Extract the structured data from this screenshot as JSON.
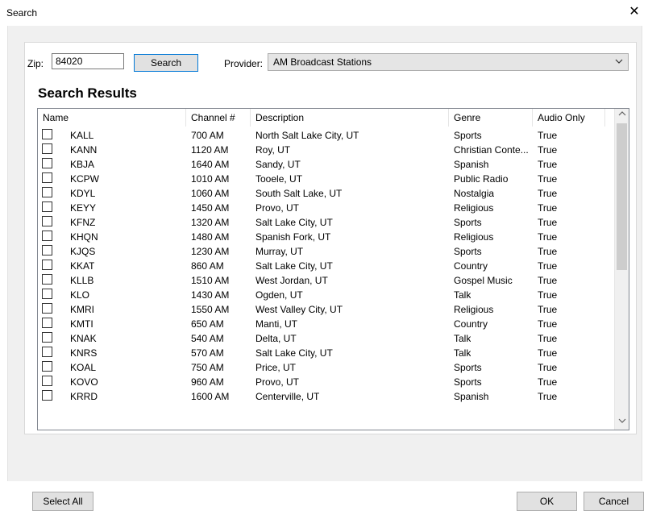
{
  "window": {
    "title": "Search",
    "close_glyph": "✕"
  },
  "search": {
    "zip_label": "Zip:",
    "zip_value": "84020",
    "search_button": "Search",
    "provider_label": "Provider:",
    "provider_value": "AM Broadcast Stations"
  },
  "results": {
    "heading": "Search Results",
    "columns": [
      "Name",
      "Channel #",
      "Description",
      "Genre",
      "Audio Only"
    ],
    "rows": [
      {
        "name": "KALL",
        "channel": "700 AM",
        "description": "North Salt Lake City, UT",
        "genre": "Sports",
        "audio_only": "True"
      },
      {
        "name": "KANN",
        "channel": "1120 AM",
        "description": "Roy, UT",
        "genre": "Christian Conte...",
        "audio_only": "True"
      },
      {
        "name": "KBJA",
        "channel": "1640 AM",
        "description": "Sandy, UT",
        "genre": "Spanish",
        "audio_only": "True"
      },
      {
        "name": "KCPW",
        "channel": "1010 AM",
        "description": "Tooele, UT",
        "genre": "Public Radio",
        "audio_only": "True"
      },
      {
        "name": "KDYL",
        "channel": "1060 AM",
        "description": "South Salt Lake, UT",
        "genre": "Nostalgia",
        "audio_only": "True"
      },
      {
        "name": "KEYY",
        "channel": "1450 AM",
        "description": "Provo, UT",
        "genre": "Religious",
        "audio_only": "True"
      },
      {
        "name": "KFNZ",
        "channel": "1320 AM",
        "description": "Salt Lake City, UT",
        "genre": "Sports",
        "audio_only": "True"
      },
      {
        "name": "KHQN",
        "channel": "1480 AM",
        "description": "Spanish Fork, UT",
        "genre": "Religious",
        "audio_only": "True"
      },
      {
        "name": "KJQS",
        "channel": "1230 AM",
        "description": "Murray, UT",
        "genre": "Sports",
        "audio_only": "True"
      },
      {
        "name": "KKAT",
        "channel": "860 AM",
        "description": "Salt Lake City, UT",
        "genre": "Country",
        "audio_only": "True"
      },
      {
        "name": "KLLB",
        "channel": "1510 AM",
        "description": "West Jordan, UT",
        "genre": "Gospel Music",
        "audio_only": "True"
      },
      {
        "name": "KLO",
        "channel": "1430 AM",
        "description": "Ogden, UT",
        "genre": "Talk",
        "audio_only": "True"
      },
      {
        "name": "KMRI",
        "channel": "1550 AM",
        "description": "West Valley City, UT",
        "genre": "Religious",
        "audio_only": "True"
      },
      {
        "name": "KMTI",
        "channel": "650 AM",
        "description": "Manti, UT",
        "genre": "Country",
        "audio_only": "True"
      },
      {
        "name": "KNAK",
        "channel": "540 AM",
        "description": "Delta, UT",
        "genre": "Talk",
        "audio_only": "True"
      },
      {
        "name": "KNRS",
        "channel": "570 AM",
        "description": "Salt Lake City, UT",
        "genre": "Talk",
        "audio_only": "True"
      },
      {
        "name": "KOAL",
        "channel": "750 AM",
        "description": "Price, UT",
        "genre": "Sports",
        "audio_only": "True"
      },
      {
        "name": "KOVO",
        "channel": "960 AM",
        "description": "Provo, UT",
        "genre": "Sports",
        "audio_only": "True"
      },
      {
        "name": "KRRD",
        "channel": "1600 AM",
        "description": "Centerville, UT",
        "genre": "Spanish",
        "audio_only": "True"
      }
    ]
  },
  "footer": {
    "select_all": "Select All",
    "ok": "OK",
    "cancel": "Cancel"
  },
  "icons": {
    "dropdown": "chevron-down-icon",
    "scroll_up": "chevron-up-icon",
    "scroll_down": "chevron-down-icon"
  },
  "colors": {
    "focus_border": "#0078d7",
    "dialog_bg": "#f0f0f0"
  }
}
